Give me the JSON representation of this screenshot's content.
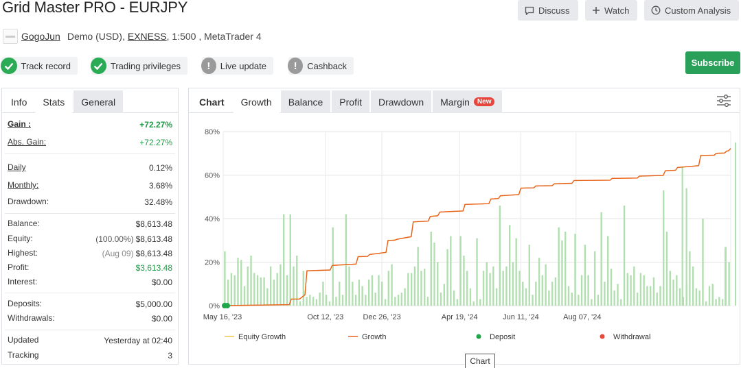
{
  "header": {
    "title": "Grid Master PRO - EURJPY",
    "buttons": {
      "discuss": "Discuss",
      "watch": "Watch",
      "custom_analysis": "Custom Analysis"
    },
    "author": "GogoJun",
    "account_type": "Demo (USD),",
    "broker": "EXNESS",
    "leverage_platform": ", 1:500 , MetaTrader 4"
  },
  "badges": {
    "track_record": "Track record",
    "trading_privileges": "Trading privileges",
    "live_update": "Live update",
    "cashback": "Cashback"
  },
  "subscribe_label": "Subscribe",
  "left_tabs": {
    "info": "Info",
    "stats": "Stats",
    "general": "General"
  },
  "stats": {
    "gain_label": "Gain :",
    "gain": "+72.27%",
    "abs_gain_label": "Abs. Gain:",
    "abs_gain": "+72.27%",
    "daily_label": "Daily",
    "daily": "0.12%",
    "monthly_label": "Monthly:",
    "monthly": "3.68%",
    "drawdown_label": "Drawdown:",
    "drawdown": "32.48%",
    "balance_label": "Balance:",
    "balance": "$8,613.48",
    "equity_label": "Equity:",
    "equity_pct": "(100.00%)",
    "equity": "$8,613.48",
    "highest_label": "Highest:",
    "highest_date": "(Aug 09)",
    "highest": "$8,613.48",
    "profit_label": "Profit:",
    "profit": "$3,613.48",
    "interest_label": "Interest:",
    "interest": "$0.00",
    "deposits_label": "Deposits:",
    "deposits": "$5,000.00",
    "withdrawals_label": "Withdrawals:",
    "withdrawals": "$0.00",
    "updated_label": "Updated",
    "updated": "Yesterday at 02:40",
    "tracking_label": "Tracking",
    "tracking": "3"
  },
  "chart_tabs": {
    "chart": "Chart",
    "growth": "Growth",
    "balance": "Balance",
    "profit": "Profit",
    "drawdown": "Drawdown",
    "margin": "Margin",
    "new_badge": "New"
  },
  "tooltip": "Chart",
  "colors": {
    "equity": "#f2c744",
    "growth": "#e8611f",
    "deposit": "#1fa54a",
    "withdrawal": "#e84a3c",
    "bars": "#b2dfb0",
    "subscribe": "#29a05a"
  },
  "chart_data": {
    "type": "line",
    "ylim": [
      0,
      80
    ],
    "yticks": [
      "0%",
      "20%",
      "40%",
      "60%",
      "80%"
    ],
    "xticks": [
      "May 16, '23",
      "Oct 12, '23",
      "Dec 26, '23",
      "Apr 19, '24",
      "Jun 11, '24",
      "Aug 07, '24"
    ],
    "series": [
      {
        "name": "Equity Growth",
        "x": [
          0,
          100,
          112,
          123,
          160,
          198,
          215,
          242,
          255,
          279,
          304,
          318,
          355,
          393,
          407,
          437,
          459,
          486,
          515,
          571,
          611,
          649,
          667,
          701,
          724,
          739,
          745
        ],
        "y": [
          0,
          3,
          3,
          16,
          18.5,
          22.5,
          23.5,
          30,
          30.5,
          38.5,
          41,
          43,
          46.5,
          49,
          50.5,
          54,
          55,
          56,
          57.5,
          58.5,
          59.5,
          62,
          63.5,
          69,
          70,
          71,
          72.27
        ]
      },
      {
        "name": "Growth",
        "x": [
          0,
          100,
          112,
          123,
          160,
          198,
          215,
          242,
          255,
          279,
          304,
          318,
          355,
          393,
          407,
          437,
          459,
          486,
          515,
          571,
          611,
          649,
          667,
          701,
          724,
          739,
          745
        ],
        "y": [
          0,
          3,
          3,
          16,
          18.5,
          22.5,
          23.5,
          30,
          30.5,
          38.5,
          41,
          43,
          46.5,
          49,
          50.5,
          54,
          55,
          56,
          57.5,
          58.5,
          59.5,
          62,
          63.5,
          69,
          70,
          71,
          72.27
        ]
      }
    ],
    "deposit_markers": [
      0,
      4
    ],
    "legend": [
      "Equity Growth",
      "Growth",
      "Deposit",
      "Withdrawal"
    ],
    "legend_position": "bottom"
  }
}
